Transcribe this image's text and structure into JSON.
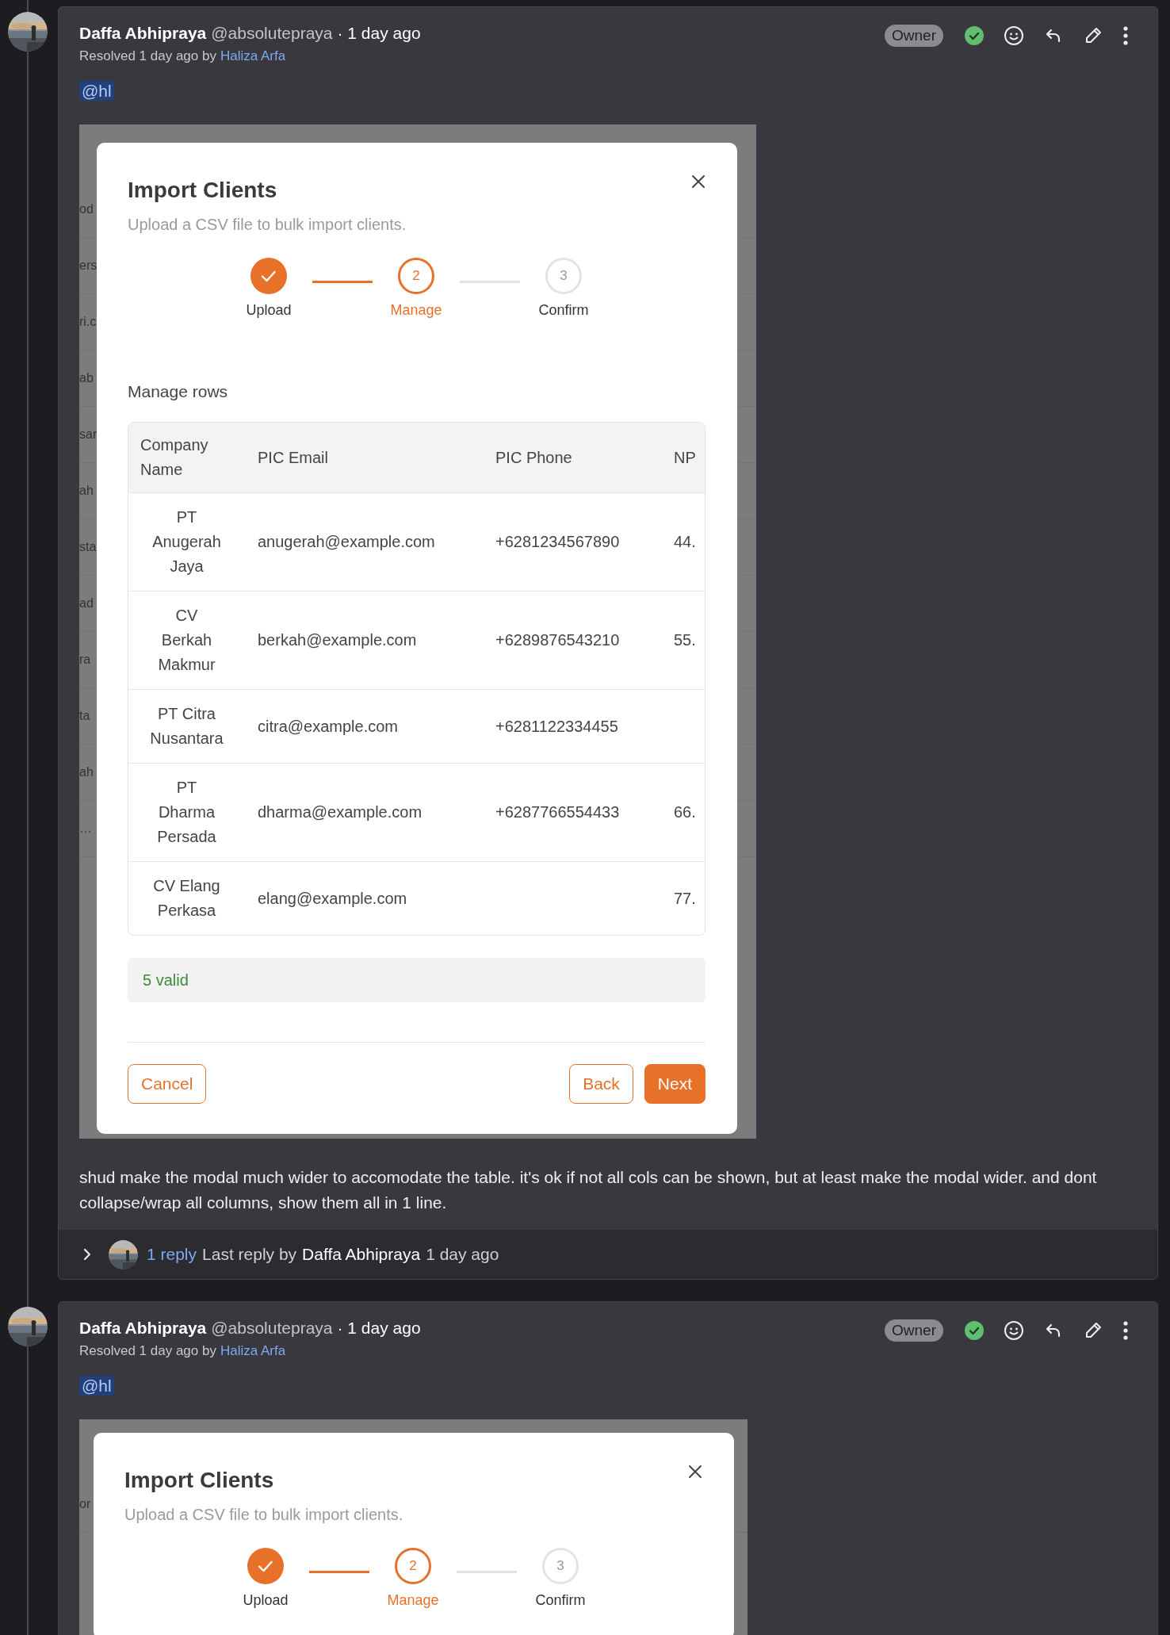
{
  "comments": [
    {
      "author": "Daffa Abhipraya",
      "handle": "@absolutepraya",
      "time": "· 1 day ago",
      "badge": "Owner",
      "resolved": true,
      "resolved_text": "Resolved 1 day ago by",
      "resolved_by": "Haliza Arfa",
      "mention": "@hl",
      "attachment": {
        "backdrop_rows": [
          {
            "right": "od"
          },
          {
            "left": "ers"
          },
          {
            "left": "ri.c"
          },
          {
            "left": "ab"
          },
          {
            "left": "sar"
          },
          {
            "left": "ah"
          },
          {
            "left": "sta"
          },
          {
            "left": "ad"
          },
          {
            "left": "ra"
          },
          {
            "left": "ta"
          },
          {
            "left": "ah"
          },
          {
            "right": "…"
          }
        ],
        "modal": {
          "title": "Import Clients",
          "subtitle": "Upload a CSV file to bulk import clients.",
          "steps": [
            {
              "label": "Upload",
              "done": true,
              "selected": false
            },
            {
              "number": "2",
              "label": "Manage",
              "done": false,
              "selected": true
            },
            {
              "number": "3",
              "label": "Confirm",
              "done": false,
              "selected": false
            }
          ],
          "section": "Manage rows",
          "table": {
            "columns": [
              "Company Name",
              "PIC Email",
              "PIC Phone",
              "NP"
            ],
            "rows": [
              [
                "PT Anugerah Jaya",
                "anugerah@example.com",
                "+6281234567890",
                "44."
              ],
              [
                "CV Berkah Makmur",
                "berkah@example.com",
                "+6289876543210",
                "55."
              ],
              [
                "PT Citra Nusantara",
                "citra@example.com",
                "+6281122334455",
                ""
              ],
              [
                "PT Dharma Persada",
                "dharma@example.com",
                "+6287766554433",
                "66."
              ],
              [
                "CV Elang Perkasa",
                "elang@example.com",
                "",
                "77."
              ]
            ]
          },
          "summary": "5 valid",
          "footer_left": [
            {
              "label": "Cancel",
              "kind": "outline"
            }
          ],
          "footer_right": [
            {
              "label": "Back",
              "kind": "outline"
            },
            {
              "label": "Next",
              "kind": "primary"
            }
          ]
        }
      },
      "body": "shud make the modal much wider to accomodate the table. it's ok if not all cols can be shown, but at least make the modal wider. and dont collapse/wrap all columns, show them all in 1 line.",
      "replies": {
        "expanded": false,
        "count": "1 reply",
        "label": "Last reply by",
        "author": "Daffa Abhipraya",
        "time": "1 day ago"
      }
    },
    {
      "author": "Daffa Abhipraya",
      "handle": "@absolutepraya",
      "time": "· 1 day ago",
      "badge": "Owner",
      "resolved": true,
      "resolved_text": "Resolved 1 day ago by",
      "resolved_by": "Haliza Arfa",
      "mention": "@hl",
      "attachment": {
        "backdrop_rows": [
          {
            "left": "or"
          }
        ],
        "modal": {
          "title": "Import Clients",
          "subtitle": "Upload a CSV file to bulk import clients.",
          "steps": [
            {
              "label": "Upload",
              "done": true,
              "selected": false
            },
            {
              "number": "2",
              "label": "Manage",
              "done": false,
              "selected": true
            },
            {
              "number": "3",
              "label": "Confirm",
              "done": false,
              "selected": false
            }
          ]
        }
      }
    }
  ]
}
